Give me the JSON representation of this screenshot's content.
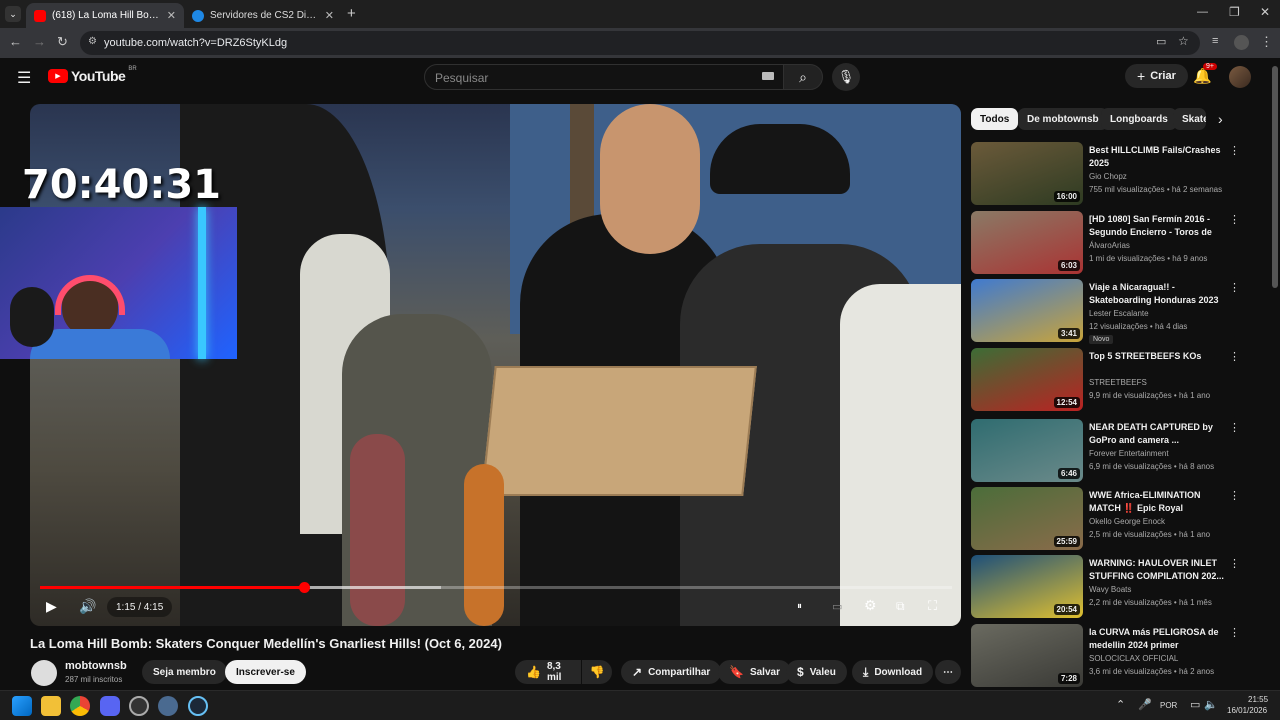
{
  "browser": {
    "tabs": [
      {
        "title": "(618) La Loma Hill Bomb: Skaters Conquer Medellín's",
        "active": true,
        "favicon_color": "#ff0000"
      },
      {
        "title": "Servidores de CS2 Disponíveis",
        "active": false,
        "favicon_color": "#1e88e5"
      }
    ],
    "new_tab": "+",
    "url": "youtube.com/watch?v=DRZ6StyKLdg"
  },
  "header": {
    "logo": "YouTube",
    "region": "BR",
    "search_placeholder": "Pesquisar",
    "create_label": "Criar",
    "notif_count": "9+"
  },
  "player": {
    "overlay_timer": "70:40:31",
    "current_time": "1:15 / 4:15",
    "progress": 0.29,
    "buffered": 0.44
  },
  "video": {
    "title": "La Loma Hill Bomb: Skaters Conquer Medellín's Gnarliest Hills! (Oct 6, 2024)",
    "channel": "mobtownsb",
    "subscribers": "287 mil inscritos",
    "member_label": "Seja membro",
    "subscribe_label": "Inscrever-se",
    "likes": "8,3 mil",
    "share_label": "Compartilhar",
    "save_label": "Salvar",
    "thanks_label": "Valeu",
    "download_label": "Download"
  },
  "chips": [
    "Todos",
    "De mobtownsb",
    "Longboards",
    "Skate"
  ],
  "recommendations": [
    {
      "title": "Best HILLCLIMB Fails/Crashes 2025",
      "channel": "Gio Chopz",
      "meta": "755 mil visualizações • há 2 semanas",
      "duration": "16:00",
      "badge": "",
      "color1": "#6b5a3a",
      "color2": "#2e3b22"
    },
    {
      "title": "[HD 1080] San Fermín 2016 - Segundo Encierro - Toros de la...",
      "channel": "ÁlvaroArias",
      "meta": "1 mi de visualizações • há 9 anos",
      "duration": "6:03",
      "badge": "",
      "color1": "#8a7a66",
      "color2": "#a33"
    },
    {
      "title": "Viaje a Nicaragua!! - Skateboarding Honduras 2023",
      "channel": "Lester Escalante",
      "meta": "12 visualizações • há 4 dias",
      "duration": "3:41",
      "badge": "Novo",
      "color1": "#3f7ad0",
      "color2": "#c9a43a"
    },
    {
      "title": "Top 5 STREETBEEFS KOs",
      "channel": "STREETBEEFS",
      "meta": "9,9 mi de visualizações • há 1 ano",
      "duration": "12:54",
      "badge": "",
      "color1": "#3c6d36",
      "color2": "#b22"
    },
    {
      "title": "NEAR DEATH CAPTURED by GoPro and camera ...",
      "channel": "Forever Entertainment",
      "meta": "6,9 mi de visualizações • há 8 anos",
      "duration": "6:46",
      "badge": "",
      "color1": "#2f6c70",
      "color2": "#6b8a8a"
    },
    {
      "title": "WWE Africa-ELIMINATION MATCH ‼️ Epic Royal RUMBL...",
      "channel": "Okello George Enock",
      "meta": "2,5 mi de visualizações • há 1 ano",
      "duration": "25:59",
      "badge": "",
      "color1": "#4b6d3a",
      "color2": "#8a6b4a"
    },
    {
      "title": "WARNING: HAULOVER INLET STUFFING COMPILATION 202...",
      "channel": "Wavy Boats",
      "meta": "2,2 mi de visualizações • há 1 mês",
      "duration": "20:54",
      "badge": "",
      "color1": "#1d4f7a",
      "color2": "#e0c030"
    },
    {
      "title": "la CURVA más PELIGROSA de medellin 2024 primer encuentr...",
      "channel": "SOLOCICLAX OFFICIAL",
      "meta": "3,6 mi de visualizações • há 2 anos",
      "duration": "7:28",
      "badge": "",
      "color1": "#6a6a60",
      "color2": "#3a3a36"
    }
  ],
  "taskbar": {
    "language": "POR",
    "time": "21:55",
    "date": "16/01/2026"
  }
}
